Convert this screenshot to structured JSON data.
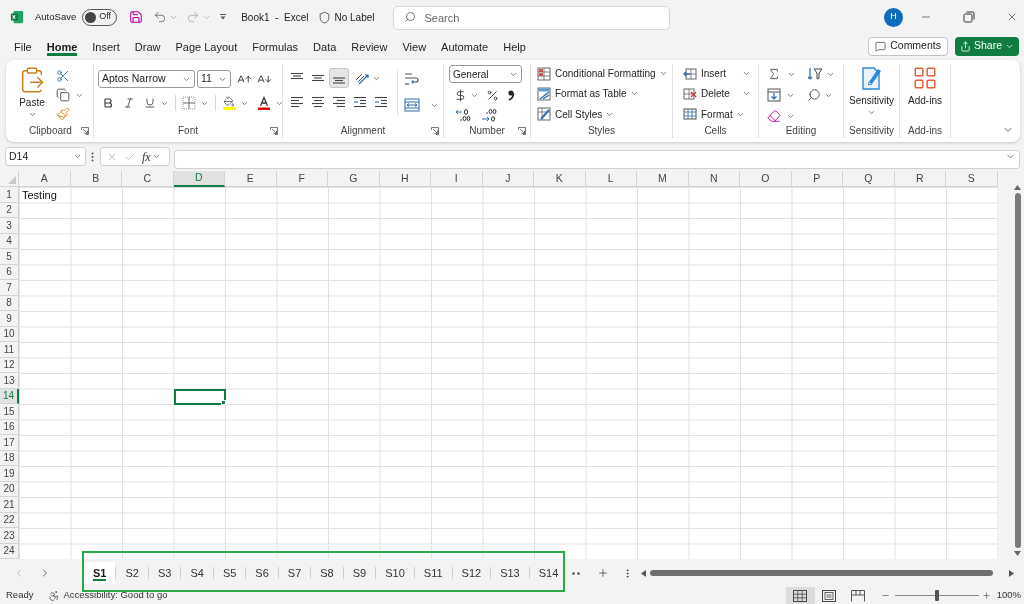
{
  "title_bar": {
    "autosave": {
      "label": "AutoSave",
      "state_label": "Off",
      "on": false
    },
    "window_title": "Book1  -  Excel",
    "sensitivity": "No Label",
    "search": {
      "placeholder": "Search"
    },
    "account_initial": "H"
  },
  "menu_tabs": [
    {
      "label": "File",
      "selected": false
    },
    {
      "label": "Home",
      "selected": true
    },
    {
      "label": "Insert",
      "selected": false
    },
    {
      "label": "Draw",
      "selected": false
    },
    {
      "label": "Page Layout",
      "selected": false
    },
    {
      "label": "Formulas",
      "selected": false
    },
    {
      "label": "Data",
      "selected": false
    },
    {
      "label": "Review",
      "selected": false
    },
    {
      "label": "View",
      "selected": false
    },
    {
      "label": "Automate",
      "selected": false
    },
    {
      "label": "Help",
      "selected": false
    }
  ],
  "actions": {
    "comments": "Comments",
    "share": "Share"
  },
  "ribbon": {
    "clipboard": {
      "label": "Clipboard",
      "paste": "Paste"
    },
    "font": {
      "label": "Font",
      "font_name": "Aptos Narrow",
      "font_size": "11"
    },
    "alignment": {
      "label": "Alignment",
      "vertical_align": [
        {
          "kind": "top",
          "selected": false
        },
        {
          "kind": "middle",
          "selected": false
        },
        {
          "kind": "bottom",
          "selected": true
        }
      ]
    },
    "number": {
      "label": "Number",
      "format": "General"
    },
    "styles": {
      "label": "Styles",
      "commands": [
        {
          "kind": "conditional",
          "label": "Conditional Formatting"
        },
        {
          "kind": "table",
          "label": "Format as Table"
        },
        {
          "kind": "cell_styles",
          "label": "Cell Styles"
        }
      ]
    },
    "cells": {
      "label": "Cells",
      "commands": [
        {
          "kind": "insert",
          "label": "Insert"
        },
        {
          "kind": "delete",
          "label": "Delete"
        },
        {
          "kind": "format",
          "label": "Format"
        }
      ]
    },
    "editing": {
      "label": "Editing"
    },
    "sensitivity": {
      "label": "Sensitivity",
      "button": "Sensitivity"
    },
    "add_ins": {
      "label": "Add-ins",
      "button": "Add-ins"
    }
  },
  "formula_bar": {
    "name_box": "D14",
    "function_label": "fx"
  },
  "sheet": {
    "columns": [
      {
        "label": "A",
        "selected": false
      },
      {
        "label": "B",
        "selected": false
      },
      {
        "label": "C",
        "selected": false
      },
      {
        "label": "D",
        "selected": true
      },
      {
        "label": "E",
        "selected": false
      },
      {
        "label": "F",
        "selected": false
      },
      {
        "label": "G",
        "selected": false
      },
      {
        "label": "H",
        "selected": false
      },
      {
        "label": "I",
        "selected": false
      },
      {
        "label": "J",
        "selected": false
      },
      {
        "label": "K",
        "selected": false
      },
      {
        "label": "L",
        "selected": false
      },
      {
        "label": "M",
        "selected": false
      },
      {
        "label": "N",
        "selected": false
      },
      {
        "label": "O",
        "selected": false
      },
      {
        "label": "P",
        "selected": false
      },
      {
        "label": "Q",
        "selected": false
      },
      {
        "label": "R",
        "selected": false
      },
      {
        "label": "S",
        "selected": false
      }
    ],
    "rows": [
      {
        "label": "1",
        "selected": false,
        "cells": [
          "Testing"
        ]
      },
      {
        "label": "2",
        "selected": false
      },
      {
        "label": "3",
        "selected": false
      },
      {
        "label": "4",
        "selected": false
      },
      {
        "label": "5",
        "selected": false
      },
      {
        "label": "6",
        "selected": false
      },
      {
        "label": "7",
        "selected": false
      },
      {
        "label": "8",
        "selected": false
      },
      {
        "label": "9",
        "selected": false
      },
      {
        "label": "10",
        "selected": false
      },
      {
        "label": "11",
        "selected": false
      },
      {
        "label": "12",
        "selected": false
      },
      {
        "label": "13",
        "selected": false
      },
      {
        "label": "14",
        "selected": true
      },
      {
        "label": "15",
        "selected": false
      },
      {
        "label": "16",
        "selected": false
      },
      {
        "label": "17",
        "selected": false
      },
      {
        "label": "18",
        "selected": false
      },
      {
        "label": "19",
        "selected": false
      },
      {
        "label": "20",
        "selected": false
      },
      {
        "label": "21",
        "selected": false
      },
      {
        "label": "22",
        "selected": false
      },
      {
        "label": "23",
        "selected": false
      },
      {
        "label": "24",
        "selected": false
      }
    ]
  },
  "sheet_tabs": [
    {
      "label": "S1",
      "selected": true
    },
    {
      "label": "S2",
      "selected": false
    },
    {
      "label": "S3",
      "selected": false
    },
    {
      "label": "S4",
      "selected": false
    },
    {
      "label": "S5",
      "selected": false
    },
    {
      "label": "S6",
      "selected": false
    },
    {
      "label": "S7",
      "selected": false
    },
    {
      "label": "S8",
      "selected": false
    },
    {
      "label": "S9",
      "selected": false
    },
    {
      "label": "S10",
      "selected": false
    },
    {
      "label": "S11",
      "selected": false
    },
    {
      "label": "S12",
      "selected": false
    },
    {
      "label": "S13",
      "selected": false
    },
    {
      "label": "S14",
      "selected": false
    }
  ],
  "status_bar": {
    "mode": "Ready",
    "accessibility": "Accessibility: Good to go",
    "views": [
      {
        "kind": "normal",
        "selected": true
      },
      {
        "kind": "page_layout",
        "selected": false
      },
      {
        "kind": "page_break",
        "selected": false
      }
    ],
    "zoom": {
      "level": 0.5,
      "reading": "100%"
    }
  }
}
